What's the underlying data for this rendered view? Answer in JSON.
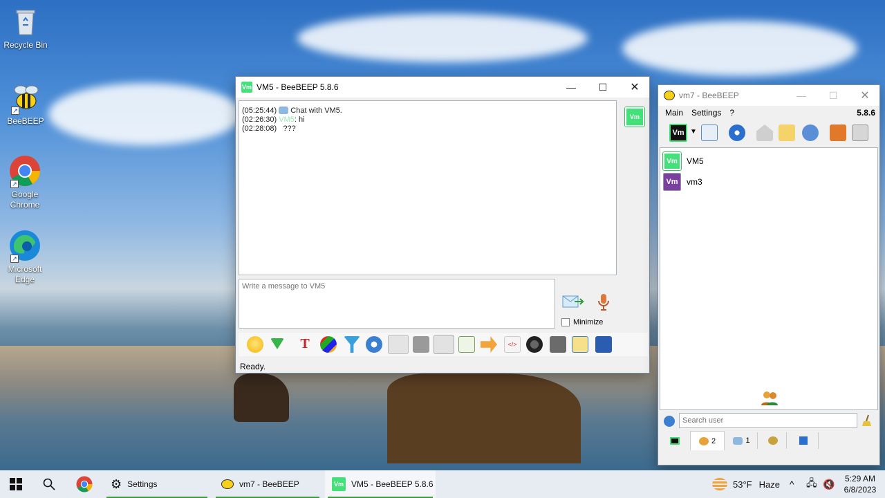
{
  "desktop": {
    "icons": [
      {
        "label": "Recycle Bin"
      },
      {
        "label": "BeeBEEP"
      },
      {
        "label": "Google Chrome"
      },
      {
        "label": "Microsoft Edge"
      }
    ]
  },
  "chat_window": {
    "title": "VM5 - BeeBEEP 5.8.6",
    "messages": [
      {
        "time": "(05:25:44)",
        "text": "Chat with VM5."
      },
      {
        "time": "(02:26:30)",
        "sender": "VM5",
        "text": ": hi"
      },
      {
        "time": "(02:28:08)",
        "text": "???"
      }
    ],
    "input_placeholder": "Write a message to VM5",
    "minimize_label": "Minimize",
    "status": "Ready.",
    "user_badge": "Vm"
  },
  "main_window": {
    "title": "vm7 - BeeBEEP",
    "menu": [
      "Main",
      "Settings",
      "?"
    ],
    "version": "5.8.6",
    "toolbar_badge": "Vm",
    "users": [
      {
        "badge": "Vm",
        "name": "VM5",
        "color": "#44e07a"
      },
      {
        "badge": "Vm",
        "name": "vm3",
        "color": "#7b3fa0"
      }
    ],
    "search_placeholder": "Search user",
    "tabs": [
      {
        "count": ""
      },
      {
        "count": "2"
      },
      {
        "count": "1"
      },
      {
        "count": ""
      },
      {
        "count": ""
      }
    ]
  },
  "taskbar": {
    "settings_label": "Settings",
    "vm7_label": "vm7 - BeeBEEP",
    "vm5_label": "VM5 - BeeBEEP 5.8.6",
    "weather_temp": "53°F",
    "weather_desc": "Haze",
    "time": "5:29 AM",
    "date": "6/8/2023"
  },
  "colors": {
    "vm_green": "#44e07a",
    "vm_purple": "#7b3fa0",
    "taskbar_bg": "#e7ebf2"
  }
}
